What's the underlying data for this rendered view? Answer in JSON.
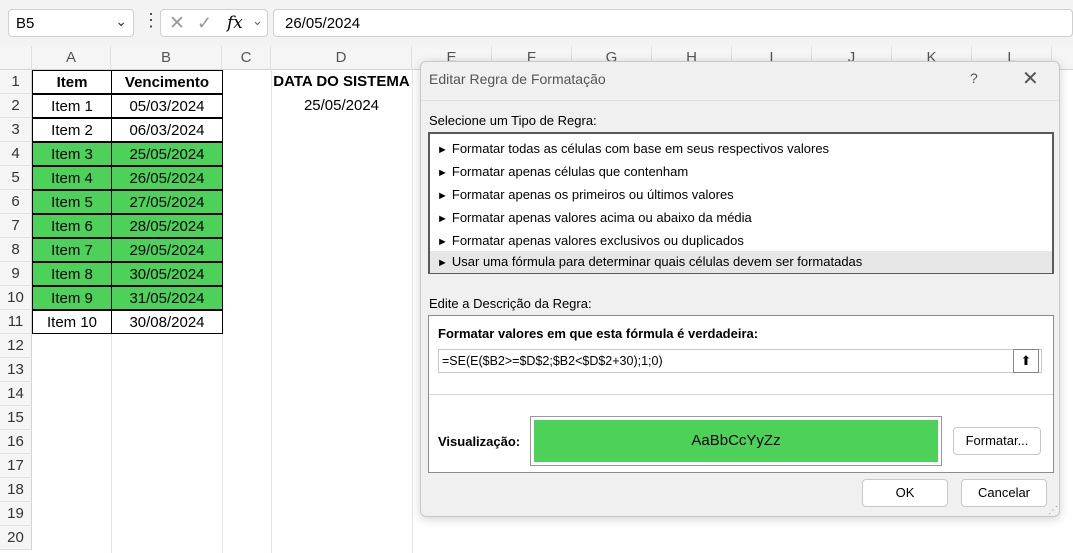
{
  "formula_bar": {
    "name_box": "B5",
    "formula": "26/05/2024",
    "icons": [
      "cancel-x-icon",
      "confirm-check-icon",
      "function-fx-icon"
    ]
  },
  "columns": [
    "A",
    "B",
    "C",
    "D",
    "E",
    "F",
    "G",
    "H",
    "I",
    "J",
    "K",
    "L"
  ],
  "rows": [
    "1",
    "2",
    "3",
    "4",
    "5",
    "6",
    "7",
    "8",
    "9",
    "10",
    "11",
    "12",
    "13",
    "14",
    "15",
    "16",
    "17",
    "18",
    "19",
    "20"
  ],
  "table": {
    "headers": [
      "Item",
      "Vencimento"
    ],
    "rows": [
      {
        "item": "Item 1",
        "date": "05/03/2024"
      },
      {
        "item": "Item 2",
        "date": "06/03/2024"
      },
      {
        "item": "Item 3",
        "date": "25/05/2024"
      },
      {
        "item": "Item 4",
        "date": "26/05/2024"
      },
      {
        "item": "Item 5",
        "date": "27/05/2024"
      },
      {
        "item": "Item 6",
        "date": "28/05/2024"
      },
      {
        "item": "Item 7",
        "date": "29/05/2024"
      },
      {
        "item": "Item 8",
        "date": "30/05/2024"
      },
      {
        "item": "Item 9",
        "date": "31/05/2024"
      },
      {
        "item": "Item 10",
        "date": "30/08/2024"
      }
    ]
  },
  "system_date": {
    "label": "DATA DO SISTEMA",
    "value": "25/05/2024"
  },
  "highlight_color": "#4cd258",
  "dialog": {
    "title": "Editar Regra de Formatação",
    "help": "?",
    "close": "✕",
    "select_type_label": "Selecione um Tipo de Regra:",
    "rule_types": [
      "Formatar todas as células com base em seus respectivos valores",
      "Formatar apenas células que contenham",
      "Formatar apenas os primeiros ou últimos valores",
      "Formatar apenas valores acima ou abaixo da média",
      "Formatar apenas valores exclusivos ou duplicados",
      "Usar uma fórmula para determinar quais células devem ser formatadas"
    ],
    "edit_desc_label": "Edite a Descrição da Regra:",
    "formula_title": "Formatar valores em que esta fórmula é verdadeira:",
    "formula": "=SE(E($B2>=$D$2;$B2<$D$2+30);1;0)",
    "preview_label": "Visualização:",
    "preview_text": "AaBbCcYyZz",
    "format_button": "Formatar...",
    "ok_button": "OK",
    "cancel_button": "Cancelar"
  }
}
